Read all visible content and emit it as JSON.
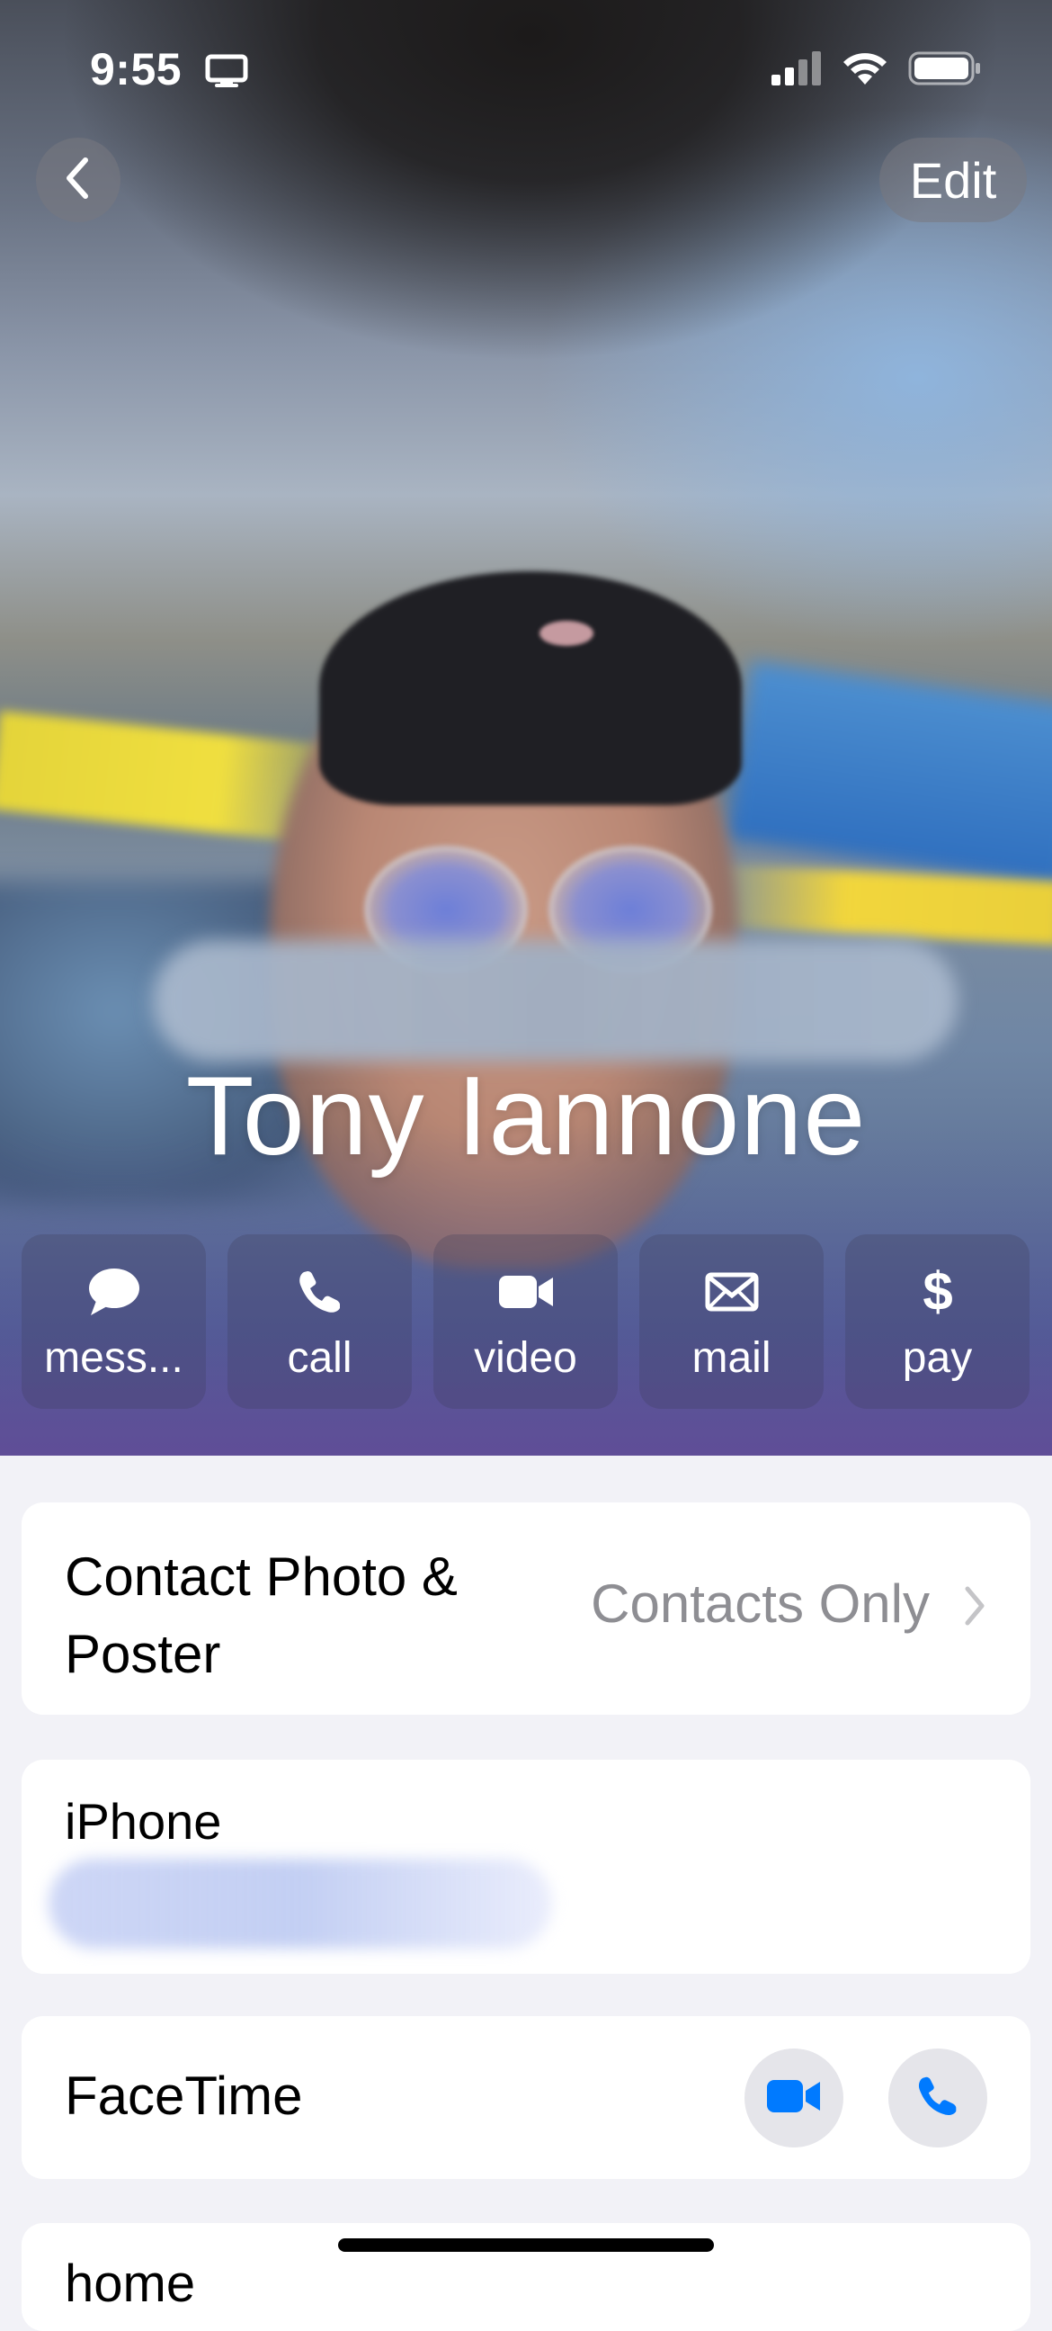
{
  "status_bar": {
    "time": "9:55",
    "screen_icon": "display-icon",
    "signal_icon": "cellular-signal-icon",
    "wifi_icon": "wifi-icon",
    "battery_icon": "battery-icon"
  },
  "nav": {
    "back_icon": "chevron-left-icon",
    "edit_label": "Edit"
  },
  "contact": {
    "name": "Tony Iannone"
  },
  "actions": [
    {
      "label": "mess...",
      "icon": "message-bubble-icon"
    },
    {
      "label": "call",
      "icon": "phone-icon"
    },
    {
      "label": "video",
      "icon": "video-camera-icon"
    },
    {
      "label": "mail",
      "icon": "envelope-icon"
    },
    {
      "label": "pay",
      "icon": "dollar-icon"
    }
  ],
  "contact_photo_poster": {
    "label": "Contact Photo & Poster",
    "value": "Contacts Only"
  },
  "phone": {
    "label": "iPhone"
  },
  "facetime": {
    "label": "FaceTime",
    "video_icon": "video-camera-icon",
    "audio_icon": "phone-icon"
  },
  "next_section": {
    "label": "home"
  },
  "colors": {
    "accent": "#007aff",
    "secondary_text": "#8e8e93",
    "grouped_background": "#f2f2f7"
  }
}
